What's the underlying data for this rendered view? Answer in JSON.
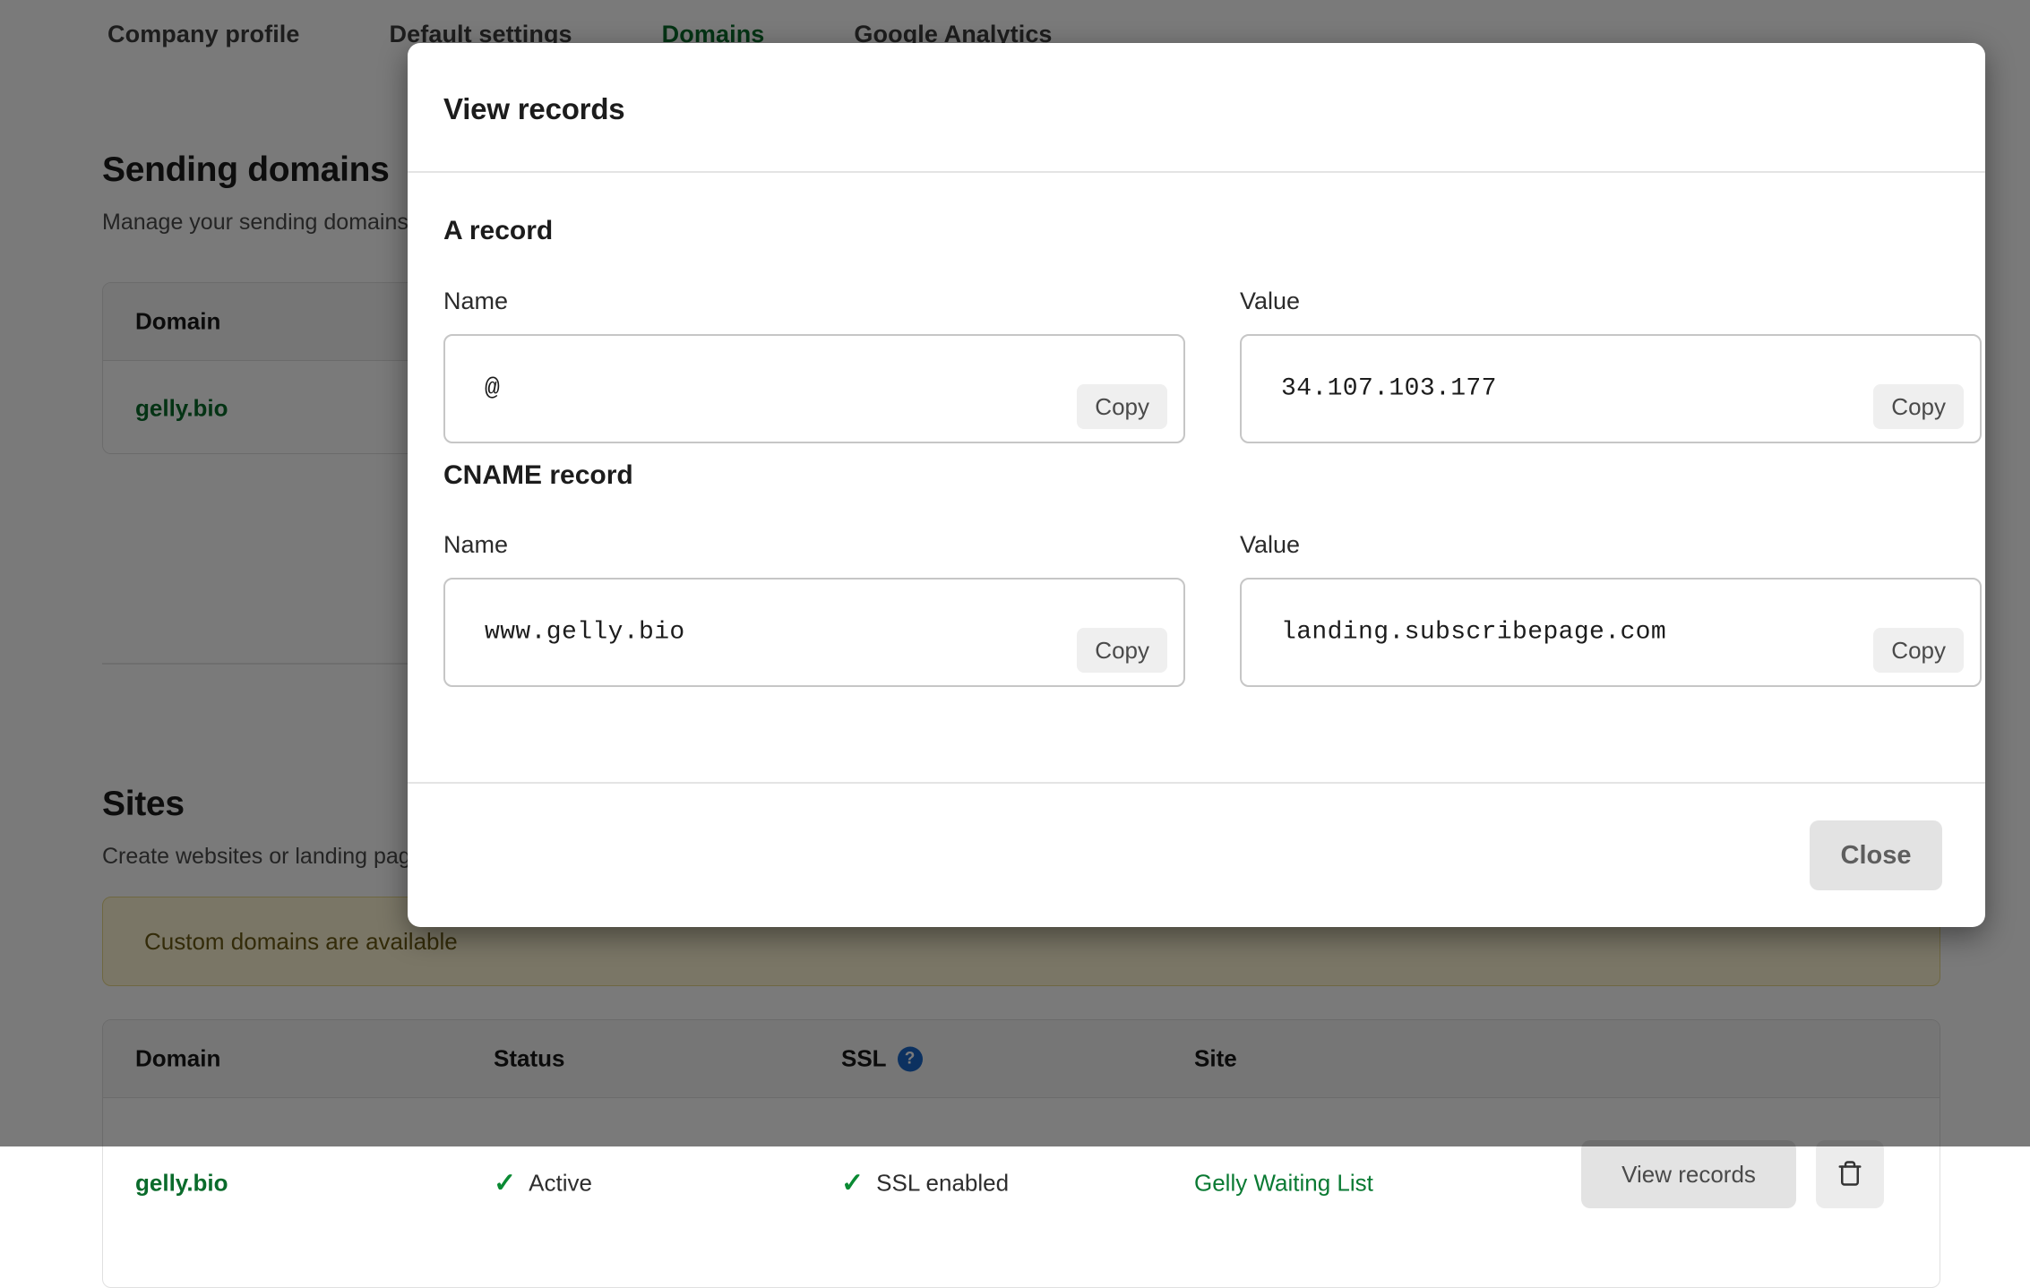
{
  "nav": {
    "tabs": [
      {
        "label": "Company profile",
        "active": false
      },
      {
        "label": "Default settings",
        "active": false
      },
      {
        "label": "Domains",
        "active": true
      },
      {
        "label": "Google Analytics",
        "active": false
      }
    ]
  },
  "sending_domains": {
    "title": "Sending domains",
    "subtitle": "Manage your sending domains",
    "table": {
      "headers": [
        "Domain"
      ],
      "rows": [
        {
          "domain": "gelly.bio"
        }
      ]
    }
  },
  "sites": {
    "title": "Sites",
    "subtitle": "Create websites or landing pages",
    "banner": "Custom domains are available",
    "table": {
      "headers": [
        "Domain",
        "Status",
        "SSL",
        "Site"
      ],
      "ssl_help_glyph": "?",
      "rows": [
        {
          "domain": "gelly.bio",
          "status": "Active",
          "status_icon": "check-icon",
          "ssl": "SSL enabled",
          "ssl_icon": "check-icon",
          "site": "Gelly Waiting List",
          "view_records_label": "View records",
          "delete_icon": "trash-icon"
        }
      ]
    }
  },
  "modal": {
    "title": "View records",
    "close_label": "Close",
    "copy_label": "Copy",
    "records": [
      {
        "heading": "A record",
        "name_label": "Name",
        "name_value": "@",
        "value_label": "Value",
        "value_value": "34.107.103.177"
      },
      {
        "heading": "CNAME record",
        "name_label": "Name",
        "name_value": "www.gelly.bio",
        "value_label": "Value",
        "value_value": "landing.subscribepage.com"
      }
    ]
  },
  "colors": {
    "brand_green": "#0a6b2b",
    "status_green": "#0a8a33",
    "help_blue": "#1a66c9",
    "warn_bg": "#fff6d6"
  }
}
